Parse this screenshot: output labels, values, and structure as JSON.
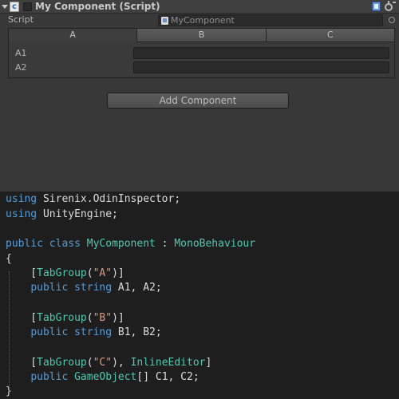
{
  "component": {
    "title": "My Component (Script)",
    "script_label": "Script",
    "script_value": "MyComponent"
  },
  "tabs": [
    {
      "label": "A"
    },
    {
      "label": "B"
    },
    {
      "label": "C"
    }
  ],
  "active_tab": "A",
  "fields": [
    {
      "label": "A1",
      "value": ""
    },
    {
      "label": "A2",
      "value": ""
    }
  ],
  "add_component_label": "Add Component",
  "code": {
    "line1": {
      "kw": "using",
      "rest": " Sirenix.OdinInspector;"
    },
    "line2": {
      "kw": "using",
      "rest": " UnityEngine;"
    },
    "line3": {
      "kw1": "public",
      "kw2": "class",
      "name": "MyComponent",
      "sep": " : ",
      "base": "MonoBehaviour"
    },
    "line4": {
      "text": "{"
    },
    "line5": {
      "open": "    [",
      "attr": "TabGroup",
      "p1": "(",
      "arg": "\"A\"",
      "p2": ")]"
    },
    "line6": {
      "indent": "    ",
      "kw1": "public",
      "kw2": "string",
      "rest": " A1, A2;"
    },
    "line7": {
      "open": "    [",
      "attr": "TabGroup",
      "p1": "(",
      "arg": "\"B\"",
      "p2": ")]"
    },
    "line8": {
      "indent": "    ",
      "kw1": "public",
      "kw2": "string",
      "rest": " B1, B2;"
    },
    "line9": {
      "open": "    [",
      "attr": "TabGroup",
      "p1": "(",
      "arg": "\"C\"",
      "p2": "), ",
      "attr2": "InlineEditor",
      "close": "]"
    },
    "line10": {
      "indent": "    ",
      "kw1": "public",
      "type": "GameObject",
      "rest": "[] C1, C2;"
    },
    "line11": {
      "text": "}"
    }
  }
}
